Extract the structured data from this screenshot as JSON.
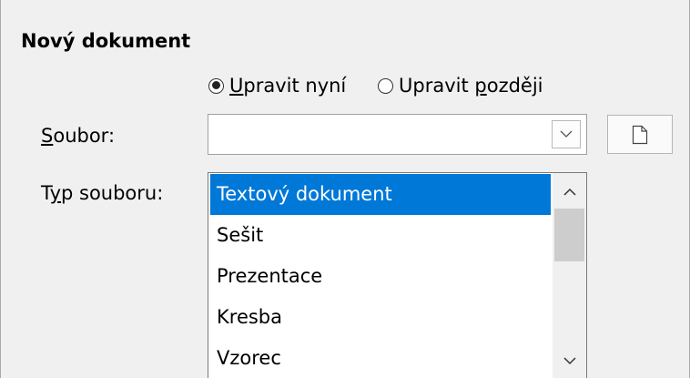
{
  "section": {
    "title": "Nový dokument"
  },
  "edit_mode": {
    "now": {
      "prefix": "",
      "accel": "U",
      "rest": "pravit nyní",
      "checked": true
    },
    "later": {
      "prefix": "Upravit ",
      "accel": "p",
      "rest": "ozději",
      "checked": false
    }
  },
  "file": {
    "label_accel": "S",
    "label_rest": "oubor:",
    "value": "",
    "dropdown_icon": "chevron-down-icon",
    "button_icon": "new-document-icon"
  },
  "file_type": {
    "label_prefix": "T",
    "label_accel": "y",
    "label_rest": "p souboru:",
    "selected_index": 0,
    "items": [
      "Textový dokument",
      "Sešit",
      "Prezentace",
      "Kresba",
      "Vzorec"
    ],
    "scroll_position": 0
  },
  "colors": {
    "selection": "#0078d7",
    "background": "#f0f0f0"
  }
}
